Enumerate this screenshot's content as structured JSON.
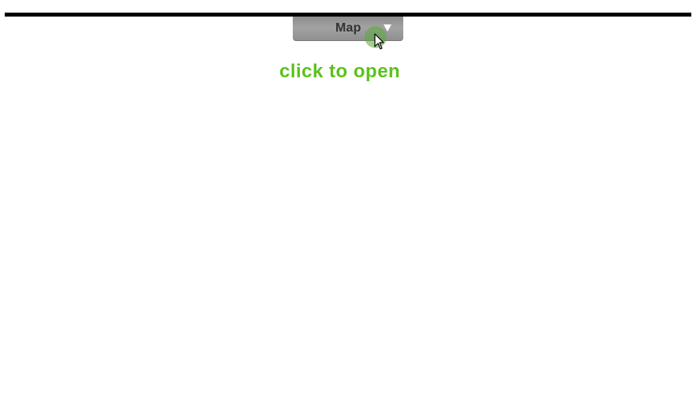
{
  "tab": {
    "label": "Map",
    "icon": "triangle-down-icon"
  },
  "hint": {
    "text": "click to open",
    "color": "#5cc21b"
  },
  "cursor": {
    "icon": "mouse-pointer-icon"
  }
}
